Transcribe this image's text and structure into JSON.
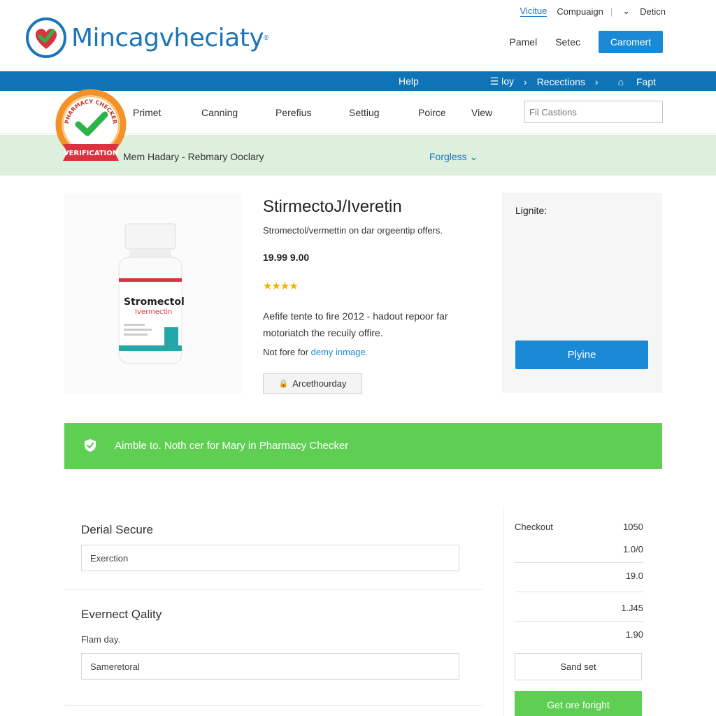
{
  "header": {
    "brand": "Mincagvheciaty",
    "brand_tm": "®",
    "top_links": [
      "Vicitue",
      "Compuaign",
      "Deticn"
    ],
    "actions": [
      "Pamel",
      "Setec"
    ],
    "primary_button": "Caromert"
  },
  "bluebar": {
    "help": "Help",
    "menu": "☰ loy",
    "receptions": "Recections",
    "report": "Fapt"
  },
  "nav": {
    "items": [
      "Primet",
      "Canning",
      "Perefius",
      "Settiug",
      "Poirce",
      "View"
    ],
    "search_placeholder": "Fil Castions"
  },
  "badge": {
    "top_text": "PHARMACY CHECKER",
    "ribbon_text": "VERIFICATION"
  },
  "breadcrumb": {
    "text": "Mem Hadary - Rebmary Ooclary",
    "filter": "Forgless"
  },
  "product": {
    "bottle_brand": "Stromectol",
    "bottle_sub": "Ivermectin",
    "title": "StirmectoJ/Iveretin",
    "subtitle": "Stromectol/vermettin on dar orgeentip offers.",
    "price": "19.99 9.00",
    "stars": "★★★★",
    "rating": 4,
    "description": "Aefife tente to fire 2012 - hadout repoor far motoriatch the recuily offire.",
    "note_prefix": "Not fore for ",
    "note_link": "demy inmage.",
    "attach_button": "Arcethourday"
  },
  "sidebox": {
    "label": "Lignite:",
    "buy_button": "Plyine"
  },
  "verify": {
    "text": "Aimble to. Noth cer for Mary in Pharmacy Checker"
  },
  "form": {
    "section1_title": "Derial Secure",
    "field1_value": "Exerction",
    "section2_title": "Evernect Qality",
    "small_label": "Flam day.",
    "field2_value": "Sameretoral"
  },
  "checkout": {
    "label": "Checkout",
    "values": [
      "1050",
      "1.0/0",
      "19.0",
      "1.J45",
      "1.90"
    ],
    "send_button": "Sand set",
    "get_button": "Get ore foright"
  },
  "colors": {
    "brand_blue": "#1a8ad6",
    "bar_blue": "#0e73b7",
    "green": "#5ecf52",
    "band_green": "#ddf0dd",
    "star": "#f2b300"
  }
}
